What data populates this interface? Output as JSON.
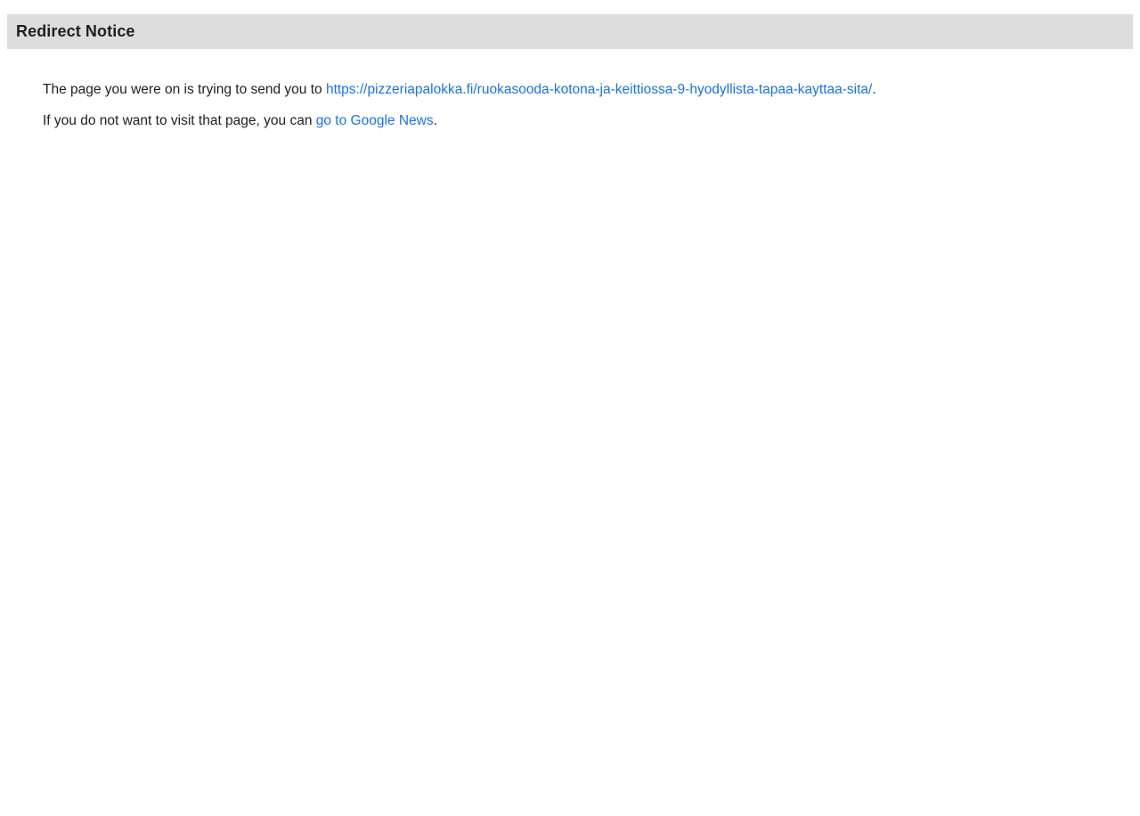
{
  "header": {
    "title": "Redirect Notice"
  },
  "message": {
    "line1_prefix": "The page you were on is trying to send you to ",
    "redirect_url": "https://pizzeriapalokka.fi/ruokasooda-kotona-ja-keittiossa-9-hyodyllista-tapaa-kayttaa-sita/",
    "line1_suffix": ".",
    "line2_prefix": "If you do not want to visit that page, you can ",
    "back_link": "go to Google News",
    "line2_suffix": "."
  },
  "colors": {
    "header_bg": "#dddddd",
    "link": "#1a73e8",
    "text": "#202124"
  }
}
